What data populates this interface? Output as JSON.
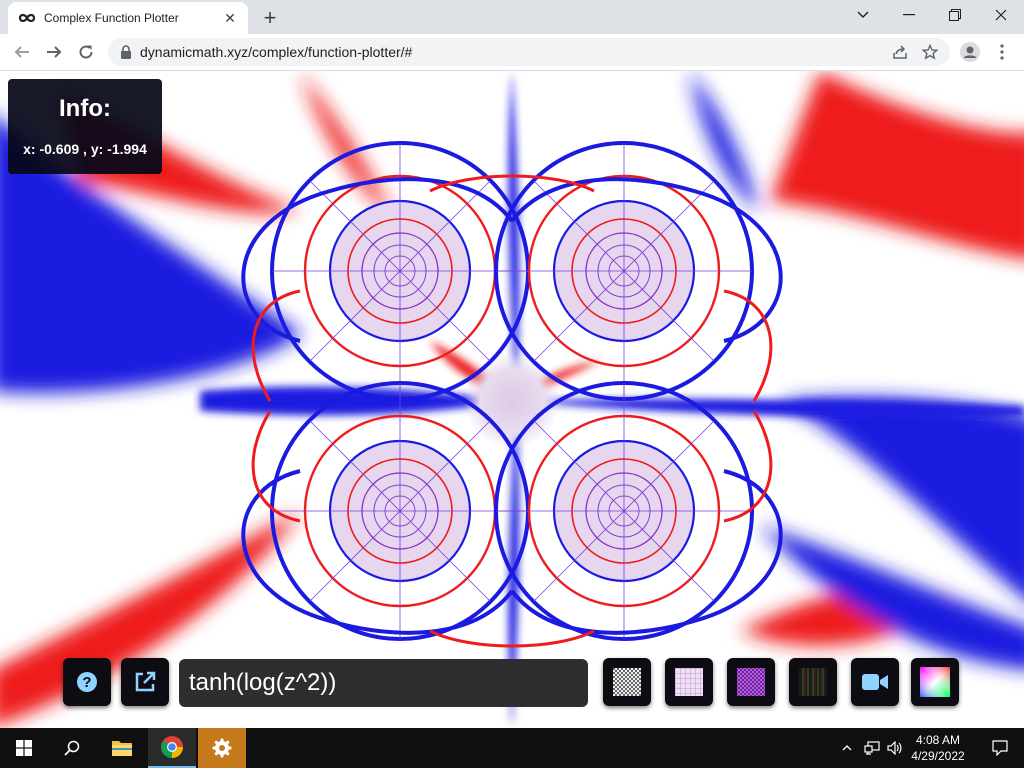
{
  "browser": {
    "tab_title": "Complex Function Plotter",
    "url": "dynamicmath.xyz/complex/function-plotter/#"
  },
  "info": {
    "title": "Info:",
    "coords": "x: -0.609 , y: -1.994"
  },
  "controls": {
    "function_value": "tanh(log(z^2))"
  },
  "colors": {
    "red": "#ee1c1c",
    "blue": "#1a1ae0",
    "lavender": "#dcc8e6",
    "panel": "#0c0c12"
  },
  "icons": [
    "help-icon",
    "open-external-icon",
    "checker-texture-icon",
    "grid-texture-icon",
    "purple-texture-icon",
    "dark-texture-icon",
    "video-camera-icon",
    "color-wheel-icon"
  ],
  "taskbar": {
    "time": "4:08 AM",
    "date": "4/29/2022"
  }
}
